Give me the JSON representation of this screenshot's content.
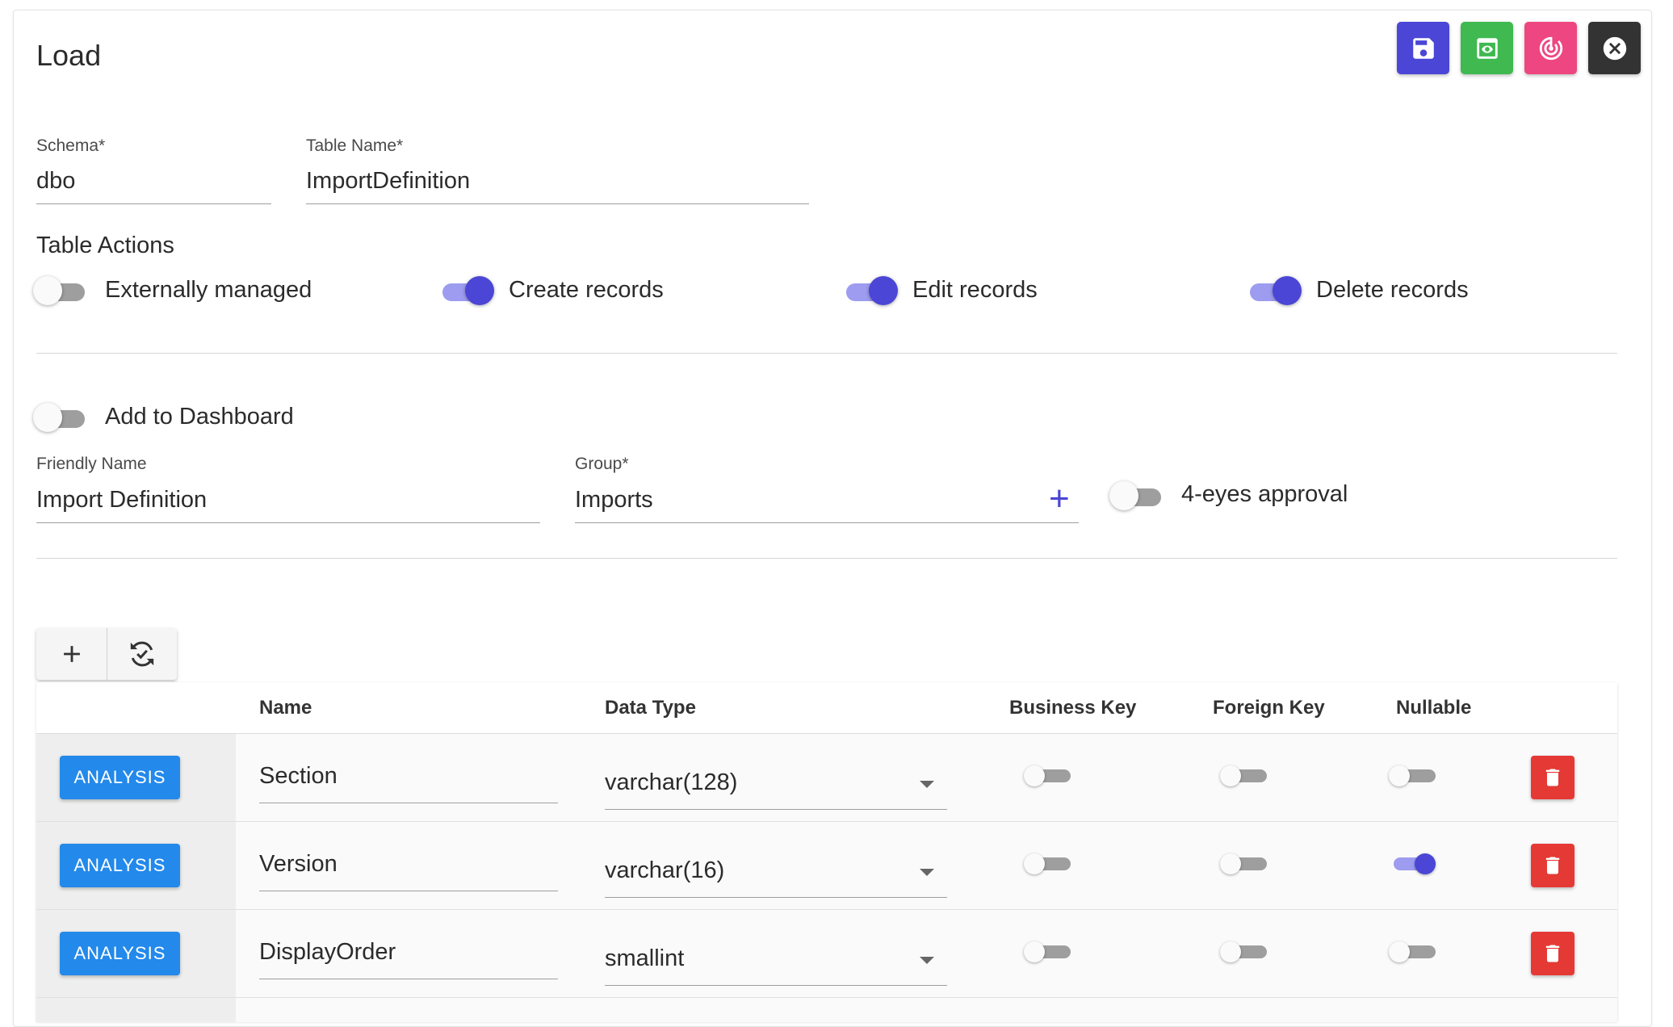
{
  "header": {
    "title": "Load"
  },
  "toolbar": {
    "save_color": "#4b46d6",
    "preview_color": "#3fb950",
    "track_color": "#ee4680",
    "close_color": "#333333"
  },
  "schema": {
    "label": "Schema*",
    "value": "dbo"
  },
  "table_name": {
    "label": "Table Name*",
    "value": "ImportDefinition"
  },
  "table_actions": {
    "title": "Table Actions",
    "toggles": [
      {
        "label": "Externally managed",
        "checked": false
      },
      {
        "label": "Create records",
        "checked": true
      },
      {
        "label": "Edit records",
        "checked": true
      },
      {
        "label": "Delete records",
        "checked": true
      }
    ]
  },
  "dashboard": {
    "label": "Add to Dashboard",
    "checked": false
  },
  "friendly_name": {
    "label": "Friendly Name",
    "value": "Import Definition"
  },
  "group": {
    "label": "Group*",
    "value": "Imports"
  },
  "four_eyes": {
    "label": "4-eyes approval",
    "checked": false
  },
  "columns_table": {
    "headers": [
      "Name",
      "Data Type",
      "Business Key",
      "Foreign Key",
      "Nullable"
    ],
    "analysis_label": "ANALYSIS",
    "rows": [
      {
        "name": "Section",
        "data_type": "varchar(128)",
        "business_key": false,
        "foreign_key": false,
        "nullable": false
      },
      {
        "name": "Version",
        "data_type": "varchar(16)",
        "business_key": false,
        "foreign_key": false,
        "nullable": true
      },
      {
        "name": "DisplayOrder",
        "data_type": "smallint",
        "business_key": false,
        "foreign_key": false,
        "nullable": false
      }
    ]
  }
}
